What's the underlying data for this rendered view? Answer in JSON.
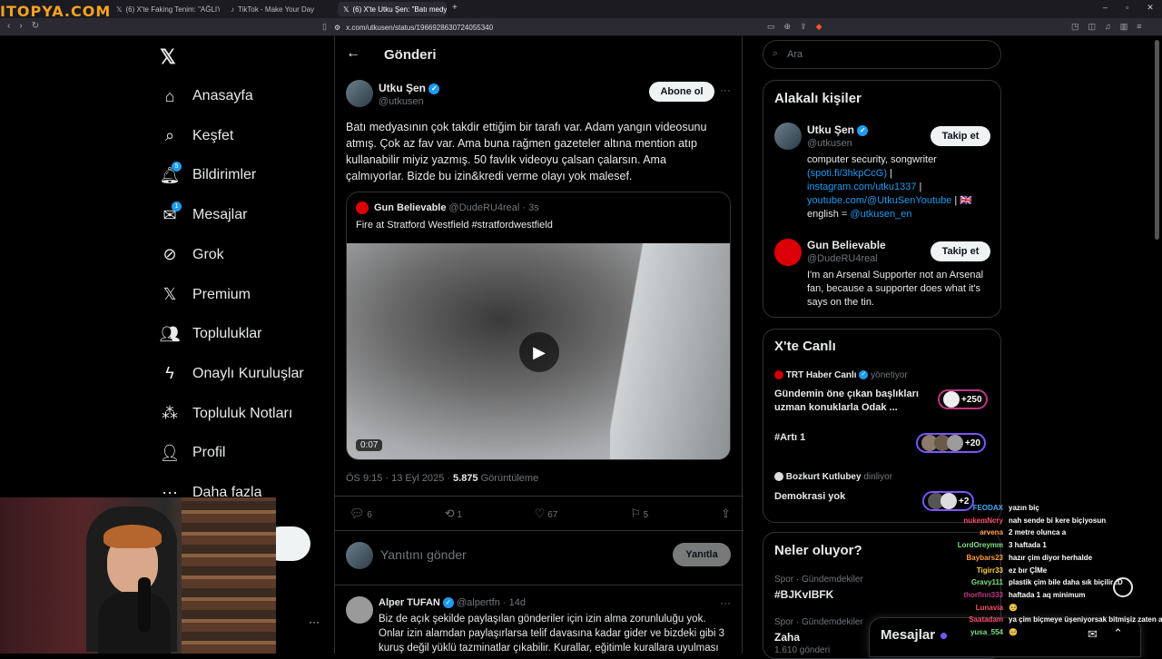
{
  "browser": {
    "tabs": [
      {
        "label": "(6) X'te Faking Tenim: \"AĞLIYORUM A"
      },
      {
        "label": "TikTok - Make Your Day"
      },
      {
        "label": "(6) X'te Utku Şen: \"Batı medyası"
      }
    ],
    "url": "x.com/utkusen/status/1966928630724055340"
  },
  "watermark": "ITOPYA.COM",
  "nav": {
    "items": [
      {
        "label": "Anasayfa",
        "icon": "home-icon"
      },
      {
        "label": "Keşfet",
        "icon": "search-icon"
      },
      {
        "label": "Bildirimler",
        "icon": "bell-icon",
        "badge": "5"
      },
      {
        "label": "Mesajlar",
        "icon": "mail-icon",
        "badge": "1"
      },
      {
        "label": "Grok",
        "icon": "grok-icon"
      },
      {
        "label": "Premium",
        "icon": "x-logo-icon"
      },
      {
        "label": "Topluluklar",
        "icon": "people-icon"
      },
      {
        "label": "Onaylı Kuruluşlar",
        "icon": "lightning-icon"
      },
      {
        "label": "Topluluk Notları",
        "icon": "notes-icon"
      },
      {
        "label": "Profil",
        "icon": "person-icon"
      },
      {
        "label": "Daha fazla",
        "icon": "more-icon"
      }
    ]
  },
  "post": {
    "header_title": "Gönderi",
    "author_name": "Utku Şen",
    "author_handle": "@utkusen",
    "subscribe_label": "Abone ol",
    "text": "Batı medyasının çok takdir ettiğim bir tarafı var. Adam yangın videosunu atmış. Çok az fav var. Ama buna rağmen gazeteler altına mention atıp kullanabilir miyiz yazmış. 50 favlık videoyu çalsan çalarsın. Ama çalmıyorlar. Bizde bu izin&kredi verme olayı yok malesef.",
    "quote": {
      "name": "Gun Believable",
      "handle": "@DudeRU4real",
      "time": "3s",
      "text": "Fire at Stratford Westfield #stratfordwestfield",
      "duration": "0:07"
    },
    "meta_time": "ÖS 9:15 · 13 Eyl 2025 ·",
    "views_count": "5.875",
    "views_label": "Görüntüleme",
    "stats": {
      "replies": "6",
      "reposts": "1",
      "likes": "67",
      "bookmarks": "5"
    },
    "reply_placeholder": "Yanıtını gönder",
    "reply_button": "Yanıtla"
  },
  "reply": {
    "name": "Alper TUFAN",
    "handle": "@alpertfn",
    "time": "· 14d",
    "text": "Biz de açık şekilde paylaşılan gönderiler için izin alma zorunluluğu yok. Onlar izin alamdan paylaşırlarsa telif davasına kadar gider ve bizdeki gibi 3 kuruş değil yüklü tazminatlar çıkabilir. Kurallar, eğitimle kurallara uyulması"
  },
  "sidebar": {
    "search_placeholder": "Ara",
    "related_title": "Alakalı kişiler",
    "follow_label": "Takip et",
    "people": [
      {
        "name": "Utku Şen",
        "handle": "@utkusen",
        "bio_1": "computer security, songwriter",
        "bio_link_1": "(spoti.fi/3hkpCcG)",
        "bio_link_2": "instagram.com/utku1337",
        "bio_link_3": "youtube.com/@UtkuSenYoutube",
        "bio_2": "english =",
        "bio_link_4": "@utkusen_en"
      },
      {
        "name": "Gun Believable",
        "handle": "@DudeRU4real",
        "bio": "I'm an Arsenal Supporter not an Arsenal fan, because a supporter does what it's says on the tin."
      }
    ],
    "live_title": "X'te Canlı",
    "live": [
      {
        "host": "TRT Haber Canlı",
        "role": "yönetiyor",
        "title": "Gündemin öne çıkan başlıkları uzman konuklarla Odak ...",
        "count": "+250"
      },
      {
        "host": "",
        "role": "",
        "title": "#Artı 1",
        "count": "+20"
      },
      {
        "host": "Bozkurt Kutlubey",
        "role": "dinliyor",
        "title": "Demokrasi yok",
        "count": "+2"
      }
    ],
    "trends_title": "Neler oluyor?",
    "trends": [
      {
        "category": "Spor · Gündemdekiler",
        "name": "#BJKvIBFK",
        "posts": ""
      },
      {
        "category": "Spor · Gündemdekiler",
        "name": "Zaha",
        "posts": "1.610 gönderi"
      }
    ],
    "messages_label": "Mesajlar"
  },
  "chat": [
    {
      "user": "FEODAX",
      "msg": "yazın biç",
      "color": "#3fa9f5"
    },
    {
      "user": "nukemNcry",
      "msg": "nah sende bi kere biçiyosun",
      "color": "#ff4d6d"
    },
    {
      "user": "arvena",
      "msg": "2 metre olunca a",
      "color": "#ff9f40"
    },
    {
      "user": "LordOreymm",
      "msg": "3 haftada 1",
      "color": "#7ee081"
    },
    {
      "user": "Baybars23",
      "msg": "hazır çim diyor herhalde",
      "color": "#ff9f40"
    },
    {
      "user": "Tigirr33",
      "msg": "ez bır ÇİMe",
      "color": "#ffd23f"
    },
    {
      "user": "Gravy111",
      "msg": "plastik çim bile daha sık biçilir :D",
      "color": "#7ee081"
    },
    {
      "user": "thorfinn333",
      "msg": "haftada 1 aq minimum",
      "color": "#c13584"
    },
    {
      "user": "Lunavia",
      "msg": "🥺",
      "color": "#ff4d6d"
    },
    {
      "user": "Saatadam",
      "msg": "ya çim biçmeye üşeniyorsak bitmişiz zaten aw",
      "color": "#ff4d6d"
    },
    {
      "user": "yusa_554",
      "msg": "🥺",
      "color": "#7ee081"
    }
  ]
}
